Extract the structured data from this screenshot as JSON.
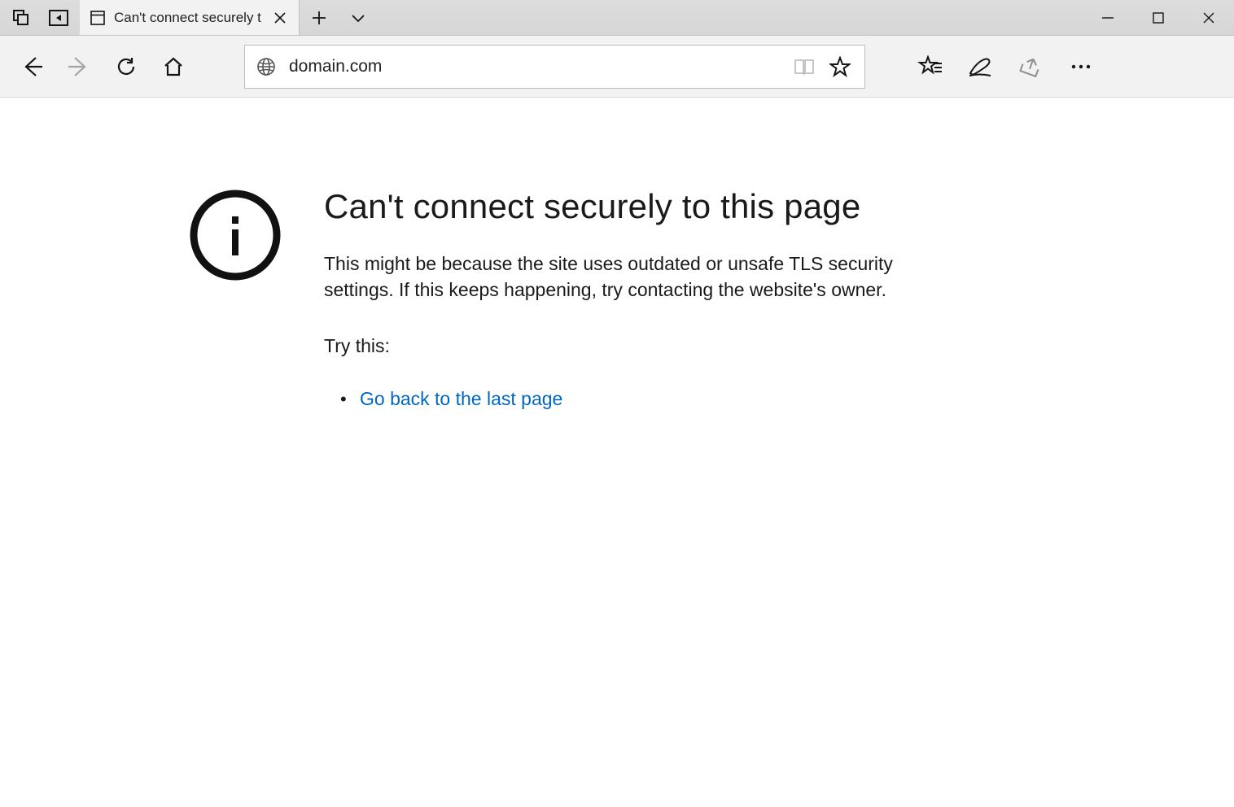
{
  "tab": {
    "title": "Can't connect securely t"
  },
  "addressbar": {
    "url": "domain.com"
  },
  "error": {
    "heading": "Can't connect securely to this page",
    "description": "This might be because the site uses outdated or unsafe TLS security settings. If this keeps happening, try contacting the website's owner.",
    "try_label": "Try this:",
    "suggestions": [
      {
        "label": "Go back to the last page"
      }
    ]
  }
}
